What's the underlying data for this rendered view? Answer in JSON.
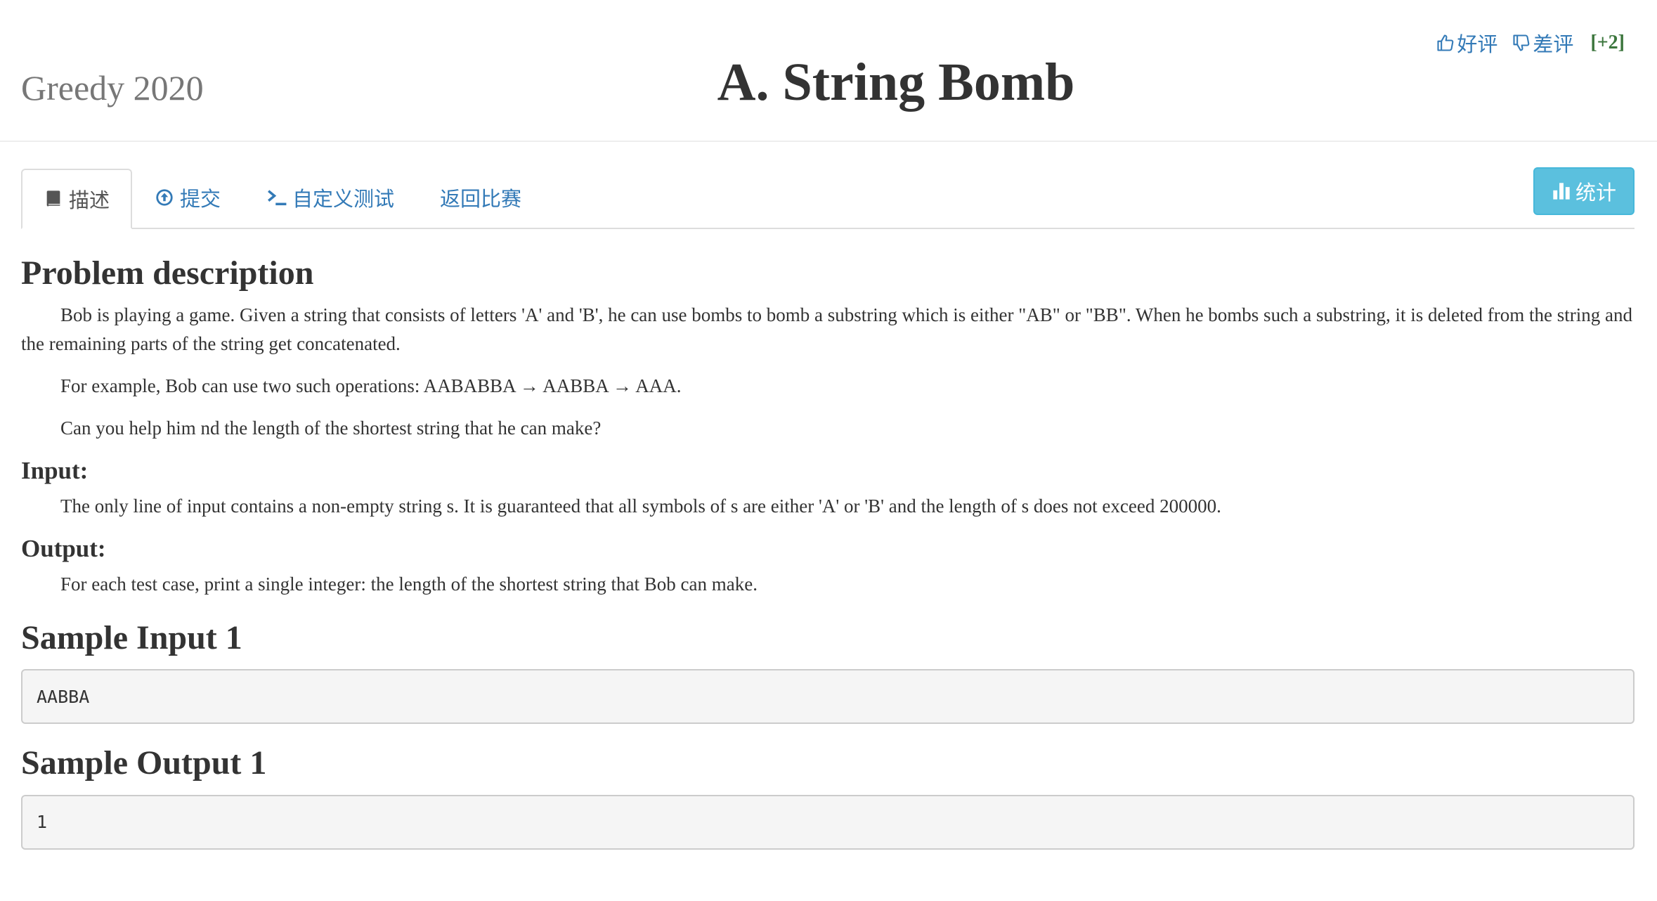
{
  "header": {
    "contest_name": "Greedy 2020",
    "problem_title": "A. String Bomb",
    "votes": {
      "like_label": "好评",
      "dislike_label": "差评",
      "score": "[+2]"
    }
  },
  "tabs": [
    {
      "label": "描述",
      "icon": "book-icon"
    },
    {
      "label": "提交",
      "icon": "upload-circle-icon"
    },
    {
      "label": "自定义测试",
      "icon": "terminal-icon"
    },
    {
      "label": "返回比赛",
      "icon": ""
    }
  ],
  "stats_button": {
    "label": "统计",
    "icon": "bar-chart-icon"
  },
  "description": {
    "heading": "Problem description",
    "paragraphs": [
      "Bob is playing a game. Given a string that consists of letters 'A' and 'B', he can use bombs to bomb a substring which is either \"AB\" or \"BB\". When he bombs such a substring, it is deleted from the string and the remaining parts of the string get concatenated.",
      "For example, Bob can use two such operations: AABABBA → AABBA → AAA.",
      "Can you help him nd the length of the shortest string that he can make?"
    ],
    "input_heading": "Input:",
    "input_text": "The only line of input contains a non-empty string s. It is guaranteed that all symbols of s are either 'A' or 'B' and the length of s does not exceed 200000.",
    "output_heading": "Output:",
    "output_text": "For each test case, print a single integer: the length of the shortest string that Bob can make."
  },
  "samples": {
    "input_heading": "Sample Input 1",
    "input_value": "AABBA",
    "output_heading": "Sample Output 1",
    "output_value": "1"
  },
  "colors": {
    "link": "#337ab7",
    "score": "#3c763d",
    "stats_button_bg": "#5bc0de",
    "sample_bg": "#f5f5f5"
  }
}
